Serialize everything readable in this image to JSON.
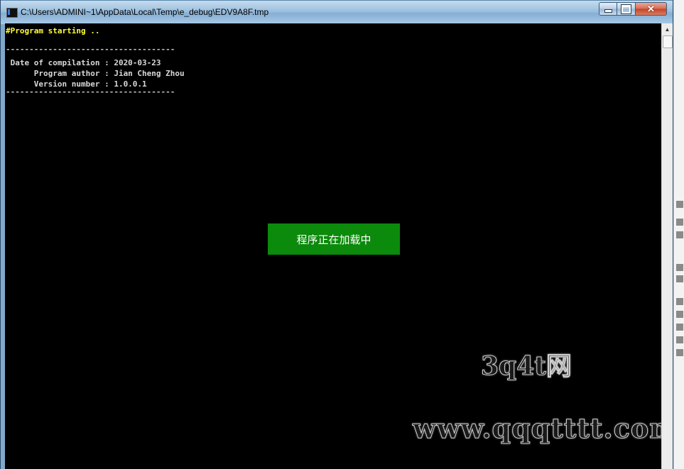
{
  "window": {
    "title": "C:\\Users\\ADMINI~1\\AppData\\Local\\Temp\\e_debug\\EDV9A8F.tmp",
    "buttons": {
      "minimize": "minimize",
      "maximize": "maximize",
      "close": "close"
    }
  },
  "console": {
    "start_line": "#Program starting ..",
    "separator": "------------------------------------",
    "lines": [
      " Date of compilation : 2020-03-23",
      "      Program author : Jian Cheng Zhou",
      "      Version number : 1.0.0.1"
    ]
  },
  "loading": {
    "label": "程序正在加载中"
  },
  "watermark": {
    "logo": "3q4t网",
    "url": "www.qqqtttt.com"
  },
  "colors": {
    "console_bg": "#000000",
    "start_text": "#ffff3b",
    "info_text": "#d9d9d9",
    "loading_bg": "#0b8a0b"
  }
}
